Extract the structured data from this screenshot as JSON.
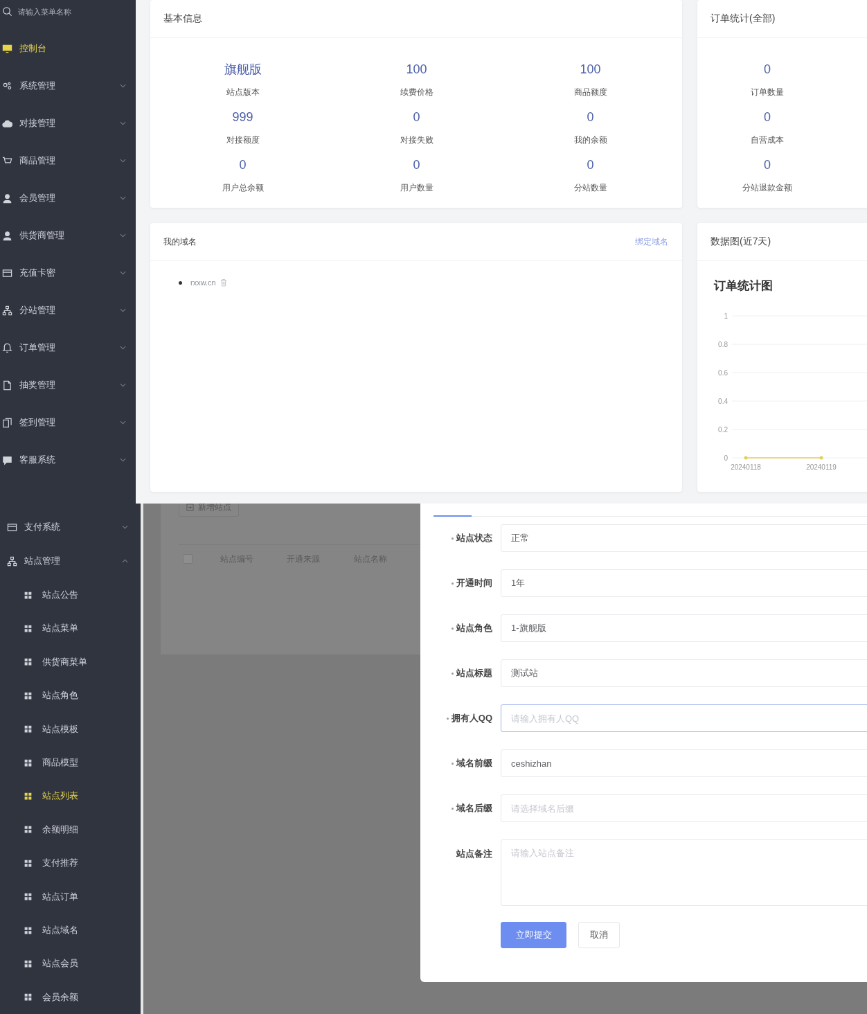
{
  "top_screen": {
    "sidebar": {
      "search": {
        "placeholder": "请输入菜单名称"
      },
      "items": [
        {
          "label": "控制台",
          "kind": "link",
          "selected": true
        },
        {
          "label": "系统管理",
          "kind": "group",
          "selected": false,
          "expanded": false
        },
        {
          "label": "对接管理",
          "kind": "group",
          "selected": false,
          "expanded": false
        },
        {
          "label": "商品管理",
          "kind": "group",
          "selected": false,
          "expanded": false
        },
        {
          "label": "会员管理",
          "kind": "group",
          "selected": false,
          "expanded": false
        },
        {
          "label": "供货商管理",
          "kind": "group",
          "selected": false,
          "expanded": false
        },
        {
          "label": "充值卡密",
          "kind": "group",
          "selected": false,
          "expanded": false
        },
        {
          "label": "分站管理",
          "kind": "group",
          "selected": false,
          "expanded": false
        },
        {
          "label": "订单管理",
          "kind": "group",
          "selected": false,
          "expanded": false
        },
        {
          "label": "抽奖管理",
          "kind": "group",
          "selected": false,
          "expanded": false
        },
        {
          "label": "签到管理",
          "kind": "group",
          "selected": false,
          "expanded": false
        },
        {
          "label": "客服系统",
          "kind": "group",
          "selected": false,
          "expanded": false
        }
      ]
    },
    "basic_info": {
      "title": "基本信息",
      "stats": [
        {
          "value": "旗舰版",
          "label": "站点版本"
        },
        {
          "value": "100",
          "label": "续费价格"
        },
        {
          "value": "100",
          "label": "商品额度"
        },
        {
          "value": "999",
          "label": "对接额度"
        },
        {
          "value": "0",
          "label": "对接失败"
        },
        {
          "value": "0",
          "label": "我的余额"
        },
        {
          "value": "0",
          "label": "用户总余额"
        },
        {
          "value": "0",
          "label": "用户数量"
        },
        {
          "value": "0",
          "label": "分站数量"
        }
      ]
    },
    "order_stats": {
      "title": "订单统计(全部)",
      "stats": [
        {
          "value": "0",
          "label": "订单数量"
        },
        {
          "value": "0",
          "label": "自营成本"
        },
        {
          "value": "0",
          "label": "分站退款金额"
        }
      ]
    },
    "domains": {
      "title": "我的域名",
      "bind_link": "绑定域名",
      "items": [
        "rxxw.cn"
      ]
    },
    "chart_panel": {
      "title": "数据图(近7天)",
      "chart_data": {
        "type": "line",
        "title": "订单统计图",
        "categories": [
          "20240118",
          "20240119"
        ],
        "series": [
          {
            "color": "#e3cf5a",
            "values": [
              0,
              0
            ]
          }
        ],
        "ylim": [
          0,
          1
        ],
        "yticks": [
          0,
          0.2,
          0.4,
          0.6,
          0.8,
          1
        ],
        "grid": true
      }
    }
  },
  "bottom_screen": {
    "sidebar": {
      "items": [
        {
          "label": "支付系统",
          "kind": "group",
          "selected": false,
          "expanded": false
        },
        {
          "label": "站点管理",
          "kind": "group",
          "selected": false,
          "expanded": true,
          "children": [
            {
              "label": "站点公告",
              "selected": false
            },
            {
              "label": "站点菜单",
              "selected": false
            },
            {
              "label": "供货商菜单",
              "selected": false
            },
            {
              "label": "站点角色",
              "selected": false
            },
            {
              "label": "站点模板",
              "selected": false
            },
            {
              "label": "商品模型",
              "selected": false
            },
            {
              "label": "站点列表",
              "selected": true
            },
            {
              "label": "余额明细",
              "selected": false
            },
            {
              "label": "支付推荐",
              "selected": false
            },
            {
              "label": "站点订单",
              "selected": false
            },
            {
              "label": "站点域名",
              "selected": false
            },
            {
              "label": "站点会员",
              "selected": false
            },
            {
              "label": "会员余额",
              "selected": false
            }
          ]
        }
      ]
    },
    "background_page": {
      "add_button": "新增站点",
      "table": {
        "select_all_checked": false,
        "columns": [
          "站点编号",
          "开通来源",
          "站点名称"
        ]
      }
    },
    "dialog": {
      "fields": [
        {
          "label": "站点状态",
          "required": true,
          "kind": "input",
          "value": "正常",
          "focused": false
        },
        {
          "label": "开通时间",
          "required": true,
          "kind": "input",
          "value": "1年",
          "focused": false
        },
        {
          "label": "站点角色",
          "required": true,
          "kind": "input",
          "value": "1-旗舰版",
          "focused": false
        },
        {
          "label": "站点标题",
          "required": true,
          "kind": "input",
          "value": "测试站",
          "focused": false
        },
        {
          "label": "拥有人QQ",
          "required": true,
          "kind": "input",
          "placeholder": "请输入拥有人QQ",
          "focused": true
        },
        {
          "label": "域名前缀",
          "required": true,
          "kind": "input",
          "value": "ceshizhan",
          "focused": false
        },
        {
          "label": "域名后缀",
          "required": true,
          "kind": "input",
          "placeholder": "请选择域名后缀",
          "focused": false
        },
        {
          "label": "站点备注",
          "required": false,
          "kind": "textarea",
          "placeholder": "请输入站点备注",
          "focused": false
        }
      ],
      "buttons": [
        {
          "label": "立即提交",
          "kind": "primary"
        },
        {
          "label": "取消",
          "kind": "default"
        }
      ]
    }
  }
}
